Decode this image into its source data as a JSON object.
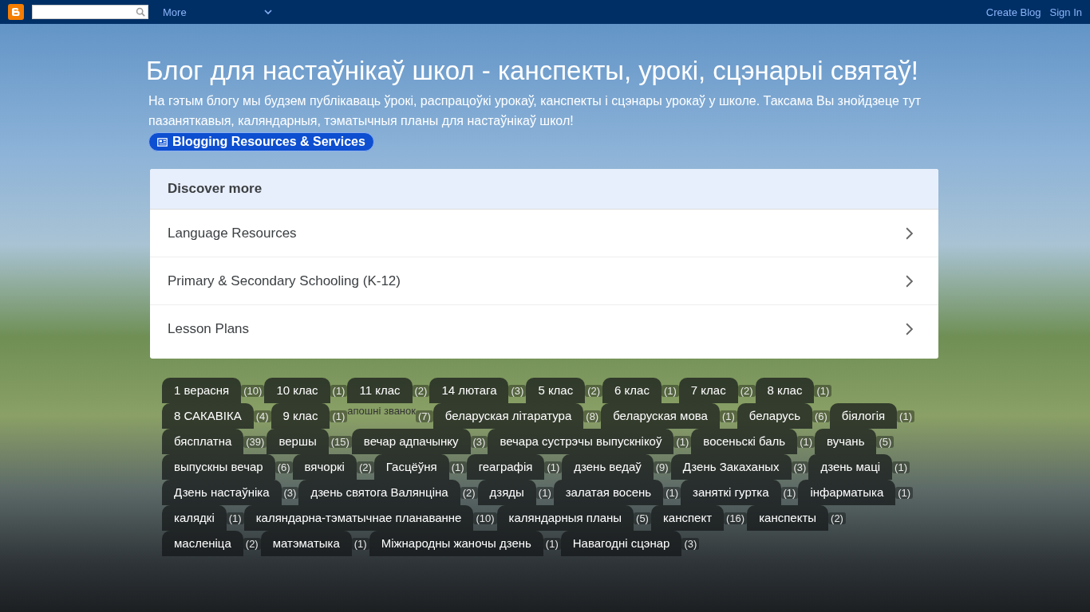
{
  "navbar": {
    "more_label": "More",
    "links": [
      "Create Blog",
      "Sign In"
    ]
  },
  "header": {
    "title": "Блог для настаўнікаў школ - канспекты, урокі, сцэнарыі святаў!",
    "description": "На гэтым блогу мы будзем публікаваць ўрокі, распрацоўкі урокаў, канспекты і сцэнары урокаў у школе. Таксама Вы знойдзеце тут пазаняткавыя, каляндарныя, тэматычныя планы для настаўнікаў школ!",
    "ad_button": "Blogging Resources & Services"
  },
  "discover": {
    "title": "Discover more",
    "items": [
      "Language Resources",
      "Primary & Secondary Schooling (K-12)",
      "Lesson Plans"
    ]
  },
  "tag_cloud": {
    "tags": [
      {
        "kind": "pill",
        "label": "1 верасня",
        "count": "(10)"
      },
      {
        "kind": "pill",
        "label": "10 клас",
        "count": "(1)"
      },
      {
        "kind": "pill",
        "label": "11 клас",
        "count": "(2)"
      },
      {
        "kind": "pill",
        "label": "14 лютага",
        "count": "(3)"
      },
      {
        "kind": "pill",
        "label": "5 клас",
        "count": "(2)"
      },
      {
        "kind": "pill",
        "label": "6 клас",
        "count": "(1)"
      },
      {
        "kind": "pill",
        "label": "7 клас",
        "count": "(2)"
      },
      {
        "kind": "pill",
        "label": "8 клас",
        "count": "(1)"
      },
      {
        "kind": "pill",
        "label": "8 САКАВІКА",
        "count": "(4)"
      },
      {
        "kind": "pill",
        "label": "9 клас",
        "count": "(1)"
      },
      {
        "kind": "plain",
        "label": "апошні званок",
        "count": "(7)"
      },
      {
        "kind": "pill",
        "label": "беларуская літаратура",
        "count": "(8)"
      },
      {
        "kind": "pill",
        "label": "беларуская мова",
        "count": "(1)"
      },
      {
        "kind": "pill",
        "label": "беларусь",
        "count": "(6)"
      },
      {
        "kind": "pill",
        "label": "біялогія",
        "count": "(1)"
      },
      {
        "kind": "pill",
        "label": "бясплатна",
        "count": "(39)"
      },
      {
        "kind": "pill",
        "label": "вершы",
        "count": "(15)"
      },
      {
        "kind": "pill",
        "label": "вечар адпачынку",
        "count": "(3)"
      },
      {
        "kind": "pill",
        "label": "вечара сустрэчы выпускнікоў",
        "count": "(1)"
      },
      {
        "kind": "pill",
        "label": "восеньскі баль",
        "count": "(1)"
      },
      {
        "kind": "pill",
        "label": "вучань",
        "count": "(5)"
      },
      {
        "kind": "pill",
        "label": "выпускны вечар",
        "count": "(6)"
      },
      {
        "kind": "pill",
        "label": "вячоркі",
        "count": "(2)"
      },
      {
        "kind": "pill",
        "label": "Гасцёўня",
        "count": "(1)"
      },
      {
        "kind": "pill",
        "label": "геаграфія",
        "count": "(1)"
      },
      {
        "kind": "pill",
        "label": "дзень ведаў",
        "count": "(9)"
      },
      {
        "kind": "pill",
        "label": "Дзень Закаханых",
        "count": "(3)"
      },
      {
        "kind": "pill",
        "label": "дзень маці",
        "count": "(1)"
      },
      {
        "kind": "pill",
        "label": "Дзень настаўніка",
        "count": "(3)"
      },
      {
        "kind": "pill",
        "label": "дзень святога Валянціна",
        "count": "(2)"
      },
      {
        "kind": "pill",
        "label": "дзяды",
        "count": "(1)"
      },
      {
        "kind": "pill",
        "label": "залатая восень",
        "count": "(1)"
      },
      {
        "kind": "pill",
        "label": "заняткі гуртка",
        "count": "(1)"
      },
      {
        "kind": "pill",
        "label": "інфарматыка",
        "count": "(1)"
      },
      {
        "kind": "pill",
        "label": "калядкі",
        "count": "(1)"
      },
      {
        "kind": "pill",
        "label": "каляндарна-тэматычнае планаванне",
        "count": "(10)"
      },
      {
        "kind": "pill",
        "label": "каляндарныя планы",
        "count": "(5)"
      },
      {
        "kind": "pill",
        "label": "канспект",
        "count": "(16)"
      },
      {
        "kind": "pill",
        "label": "канспекты",
        "count": "(2)"
      },
      {
        "kind": "pill",
        "label": "масленіца",
        "count": "(2)"
      },
      {
        "kind": "pill",
        "label": "матэматыка",
        "count": "(1)"
      },
      {
        "kind": "pill",
        "label": "Міжнародны жаночы дзень",
        "count": "(1)"
      },
      {
        "kind": "pill",
        "label": "Навагодні сцэнар",
        "count": "(3)"
      }
    ]
  }
}
